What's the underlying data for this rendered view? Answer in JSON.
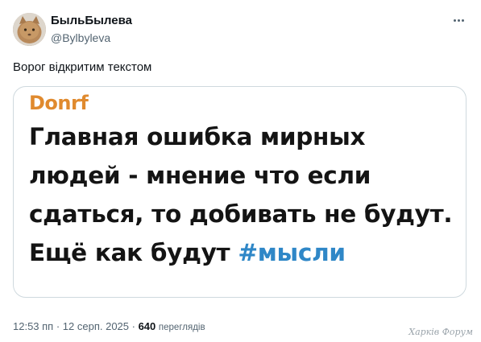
{
  "author": {
    "display_name": "БыльБылева",
    "handle": "@Bylbyleva"
  },
  "tweet": {
    "text": "Ворог відкритим текстом"
  },
  "embedded_post": {
    "author": "Donrf",
    "lines": [
      "Главная ошибка мирных",
      "людей - мнение что если",
      "сдаться, то добивать не будут.",
      "Ещё как будут "
    ],
    "hashtag": "#мысли"
  },
  "meta": {
    "time": "12:53 пп",
    "separator1": " · ",
    "date": "12 серп. 2025",
    "separator2": " · ",
    "views_count": "640",
    "views_label": "переглядів"
  },
  "watermark": "Харків Форум",
  "colors": {
    "embedded_author": "#e08a2e",
    "hashtag": "#2f87c7",
    "secondary_text": "#536471"
  },
  "icons": {
    "more": "more-horizontal-icon"
  }
}
